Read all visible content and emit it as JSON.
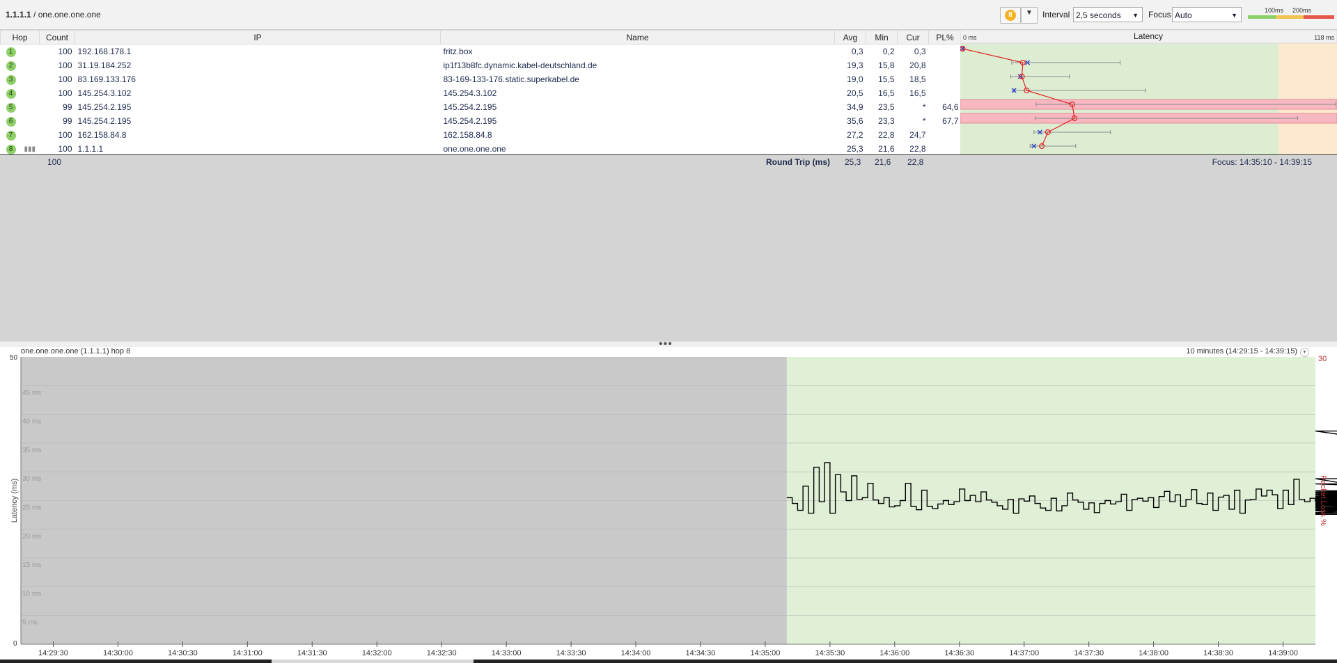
{
  "header": {
    "target_ip": "1.1.1.1",
    "separator": " / ",
    "target_name": "one.one.one.one",
    "pause_icon": "pause-icon",
    "interval_label": "Interval",
    "interval_value": "2,5 seconds",
    "focus_label": "Focus",
    "focus_value": "Auto",
    "scale_labels": [
      "100ms",
      "200ms"
    ],
    "scale_colors": [
      "#8ccf6a",
      "#f2c24f",
      "#e5564b"
    ]
  },
  "table": {
    "columns": [
      "Hop",
      "Count",
      "IP",
      "Name",
      "Avg",
      "Min",
      "Cur",
      "PL%"
    ],
    "latency_header": "Latency",
    "latency_min_label": "0 ms",
    "latency_max_label": "118 ms",
    "rows": [
      {
        "hop": "1",
        "count": "100",
        "ip": "192.168.178.1",
        "name": "fritz.box",
        "avg": "0,3",
        "min": "0,2",
        "cur": "0,3",
        "star": "",
        "pl": ""
      },
      {
        "hop": "2",
        "count": "100",
        "ip": "31.19.184.252",
        "name": "ip1f13b8fc.dynamic.kabel-deutschland.de",
        "avg": "19,3",
        "min": "15,8",
        "cur": "20,8",
        "star": "",
        "pl": ""
      },
      {
        "hop": "3",
        "count": "100",
        "ip": "83.169.133.176",
        "name": "83-169-133-176.static.superkabel.de",
        "avg": "19,0",
        "min": "15,5",
        "cur": "18,5",
        "star": "",
        "pl": ""
      },
      {
        "hop": "4",
        "count": "100",
        "ip": "145.254.3.102",
        "name": "145.254.3.102",
        "avg": "20,5",
        "min": "16,5",
        "cur": "16,5",
        "star": "",
        "pl": ""
      },
      {
        "hop": "5",
        "count": "99",
        "ip": "145.254.2.195",
        "name": "145.254.2.195",
        "avg": "34,9",
        "min": "23,5",
        "cur": "",
        "star": "*",
        "pl": "64,6"
      },
      {
        "hop": "6",
        "count": "99",
        "ip": "145.254.2.195",
        "name": "145.254.2.195",
        "avg": "35,6",
        "min": "23,3",
        "cur": "",
        "star": "*",
        "pl": "67,7"
      },
      {
        "hop": "7",
        "count": "100",
        "ip": "162.158.84.8",
        "name": "162.158.84.8",
        "avg": "27,2",
        "min": "22,8",
        "cur": "24,7",
        "star": "",
        "pl": ""
      },
      {
        "hop": "8",
        "count": "100",
        "ip": "1.1.1.1",
        "name": "one.one.one.one",
        "avg": "25,3",
        "min": "21,6",
        "cur": "22,8",
        "star": "",
        "pl": ""
      }
    ],
    "summary": {
      "count": "100",
      "label": "Round Trip (ms)",
      "avg": "25,3",
      "min": "21,6",
      "cur": "22,8",
      "focus_range": "Focus: 14:35:10 - 14:39:15"
    }
  },
  "latency_overview": {
    "x_max_ms": 118,
    "green_until_ms": 100,
    "hops": [
      {
        "avg": 0.3,
        "min": 0.2,
        "max": 0.5,
        "cur": 0.3,
        "loss": false
      },
      {
        "avg": 19.3,
        "min": 15.8,
        "max": 50,
        "cur": 20.8,
        "loss": false
      },
      {
        "avg": 19.0,
        "min": 15.5,
        "max": 34,
        "cur": 18.5,
        "loss": false
      },
      {
        "avg": 20.5,
        "min": 16.5,
        "max": 58,
        "cur": 16.5,
        "loss": false
      },
      {
        "avg": 34.9,
        "min": 23.5,
        "max": 118,
        "cur": null,
        "loss": true
      },
      {
        "avg": 35.6,
        "min": 23.3,
        "max": 106,
        "cur": null,
        "loss": true
      },
      {
        "avg": 27.2,
        "min": 22.8,
        "max": 47,
        "cur": 24.7,
        "loss": false
      },
      {
        "avg": 25.3,
        "min": 21.6,
        "max": 36,
        "cur": 22.8,
        "loss": false
      }
    ]
  },
  "lower": {
    "title": "one.one.one.one (1.1.1.1) hop 8",
    "range_label": "10 minutes (14:29:15 - 14:39:15)"
  },
  "chart_data": {
    "type": "line",
    "ylabel": "Latency (ms)",
    "y2label": "Packet Loss %",
    "ylim": [
      0,
      50
    ],
    "y2_max_label": "30",
    "y_ticks": [
      "5 ms",
      "10 ms",
      "15 ms",
      "20 ms",
      "25 ms",
      "30 ms",
      "35 ms",
      "40 ms",
      "45 ms"
    ],
    "y_axis_min_label": "0",
    "y_axis_max_label": "50",
    "xlim": [
      "14:29:15",
      "14:39:15"
    ],
    "x_ticks": [
      "14:29:30",
      "14:30:00",
      "14:30:30",
      "14:31:00",
      "14:31:30",
      "14:32:00",
      "14:32:30",
      "14:33:00",
      "14:33:30",
      "14:34:00",
      "14:34:30",
      "14:35:00",
      "14:35:30",
      "14:36:00",
      "14:36:30",
      "14:37:00",
      "14:37:30",
      "14:38:00",
      "14:38:30",
      "14:39:00"
    ],
    "focus_range": [
      "14:35:10",
      "14:39:15"
    ],
    "series": [
      {
        "start": "14:35:10",
        "step_seconds": 2.5,
        "values": [
          25.5,
          24.5,
          23.3,
          27.5,
          22.8,
          30.8,
          24.8,
          31.6,
          22.8,
          29.5,
          26.5,
          25.0,
          29.3,
          25.2,
          25.5,
          28.0,
          25.1,
          24.5,
          25.5,
          23.9,
          24.1,
          25.0,
          28.0,
          24.0,
          23.4,
          26.8,
          24.0,
          23.6,
          24.4,
          25.0,
          24.3,
          24.8,
          27.0,
          25.0,
          25.9,
          24.8,
          26.5,
          25.1,
          24.7,
          24.1,
          23.5,
          25.2,
          22.8,
          25.3,
          24.9,
          25.8,
          24.5,
          23.7,
          23.3,
          25.4,
          23.2,
          24.1,
          26.3,
          25.1,
          24.7,
          23.5,
          24.6,
          22.9,
          24.5,
          25.0,
          24.4,
          24.8,
          26.1,
          23.3,
          25.2,
          25.4,
          24.9,
          25.5,
          23.8,
          25.7,
          26.6,
          24.8,
          26.0,
          24.0,
          25.2,
          26.9,
          24.5,
          24.3,
          26.3,
          23.3,
          25.6,
          25.9,
          23.5,
          26.8,
          22.8,
          25.1,
          25.2,
          27.0,
          25.8,
          26.8,
          26.0,
          23.6,
          26.8,
          24.3,
          28.7,
          25.2,
          24.8,
          25.4,
          24.9,
          25.2,
          24.4,
          25.1,
          25.3,
          25.2,
          24.5,
          24.1,
          26.0,
          24.8,
          25.0,
          24.1,
          26.5,
          23.8,
          25.3,
          25.4,
          22.6,
          25.6,
          23.3,
          25.2,
          28.8,
          25.6,
          24.8,
          26.3,
          25.5,
          24.6,
          26.5,
          24.0,
          24.2,
          23.4,
          26.3,
          25.3,
          24.4,
          25.3,
          25.6,
          24.8,
          23.4,
          25.9,
          24.8,
          24.5,
          24.9,
          25.3,
          23.5,
          24.5,
          25.7,
          25.1,
          24.9,
          24.8,
          25.2,
          26.5,
          25.3,
          24.8,
          25.1,
          24.9,
          23.3,
          25.9,
          24.4,
          24.8,
          26.1,
          24.2,
          25.3,
          24.9,
          22.9,
          26.3,
          24.6,
          25.5,
          26.0,
          25.0,
          23.7,
          26.1,
          24.7,
          25.6,
          25.4,
          22.8,
          24.8,
          24.3,
          25.1,
          25.3,
          24.5,
          26.0,
          25.7,
          25.2,
          25.0,
          25.3,
          27.9,
          25.0,
          25.0,
          24.0,
          24.3,
          25.4,
          25.5,
          25.6,
          25.4,
          25.1,
          25.4,
          26.7,
          25.3,
          25.0,
          24.0,
          25.4,
          37.1,
          23.5,
          23.2
        ]
      }
    ]
  }
}
